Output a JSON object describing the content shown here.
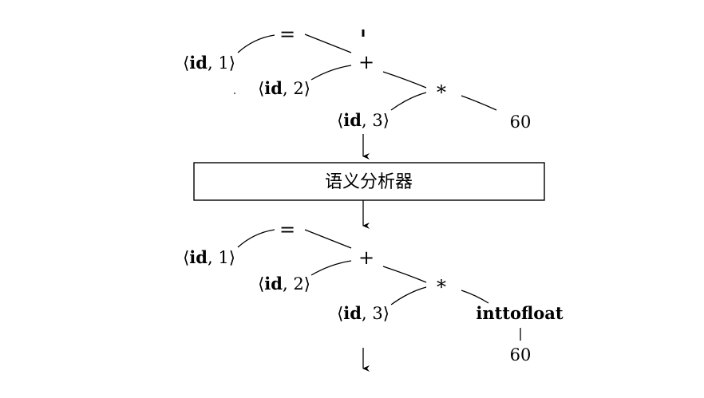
{
  "top_tree": {
    "assign": "=",
    "id1": {
      "name": "id",
      "num": "1"
    },
    "plus": "+",
    "id2": {
      "name": "id",
      "num": "2"
    },
    "times": "*",
    "id3": {
      "name": "id",
      "num": "3"
    },
    "const": "60"
  },
  "analyzer_label": "语义分析器",
  "bottom_tree": {
    "assign": "=",
    "id1": {
      "name": "id",
      "num": "1"
    },
    "plus": "+",
    "id2": {
      "name": "id",
      "num": "2"
    },
    "times": "*",
    "id3": {
      "name": "id",
      "num": "3"
    },
    "conv": "inttofloat",
    "const": "60"
  }
}
